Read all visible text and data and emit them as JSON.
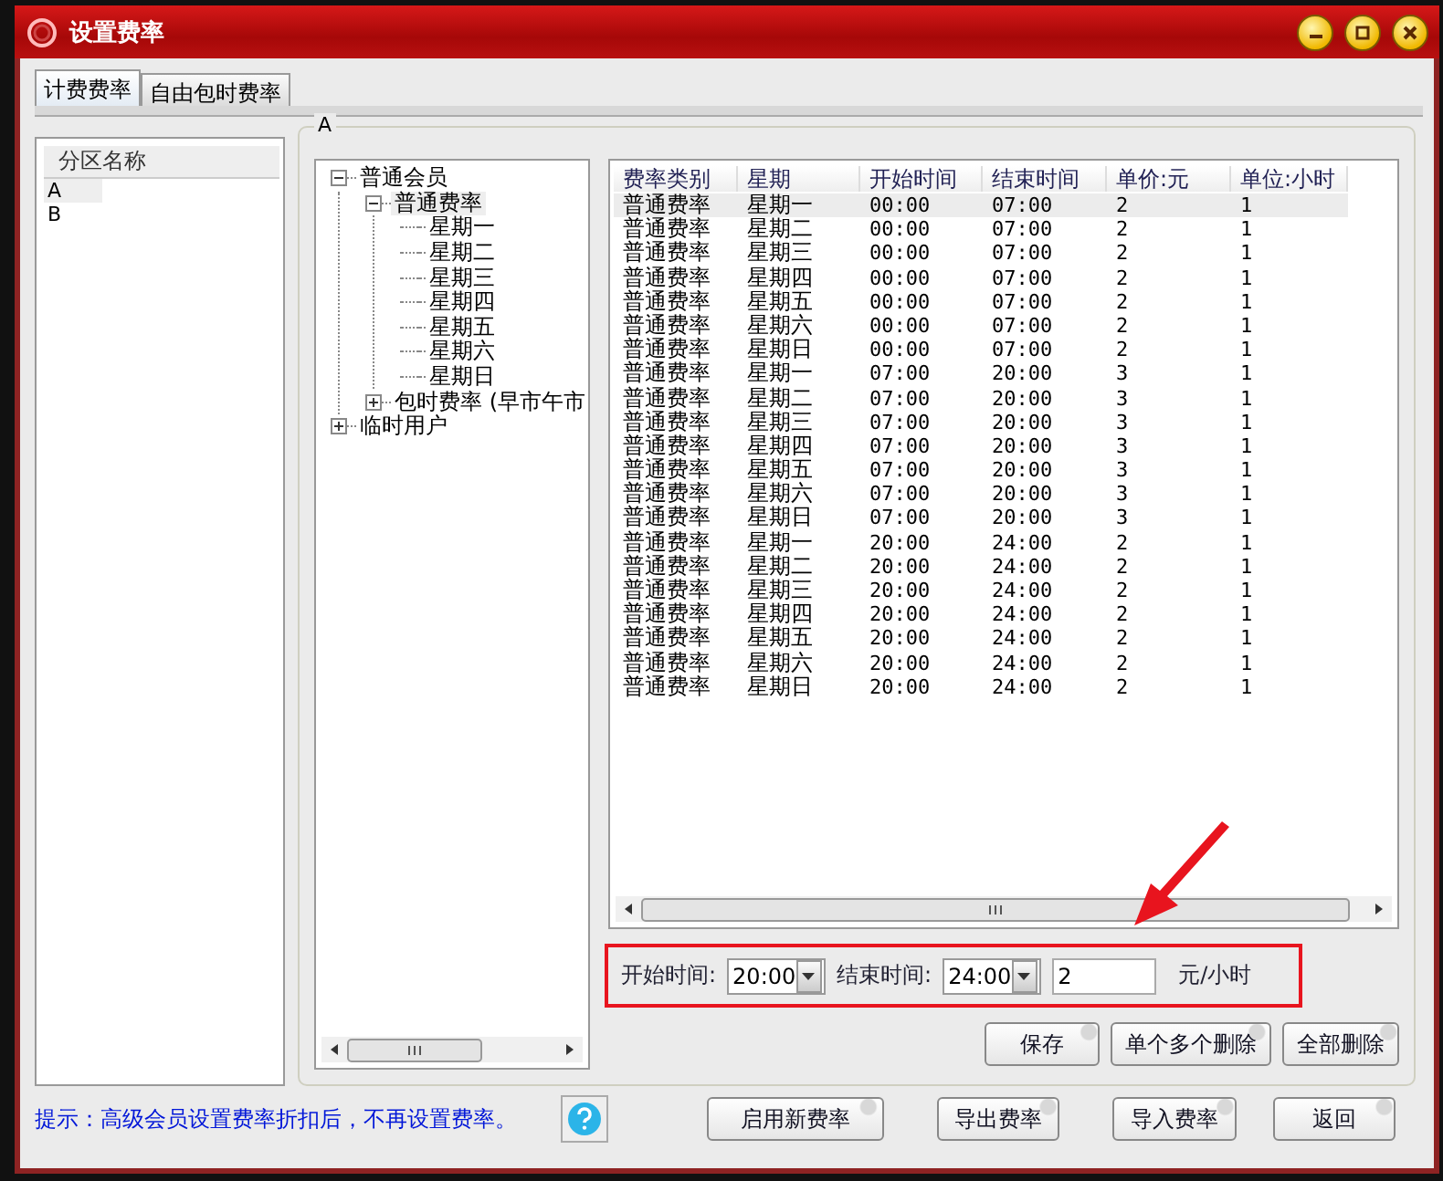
{
  "window": {
    "title": "设置费率"
  },
  "tabs": [
    {
      "label": "计费费率",
      "selected": true
    },
    {
      "label": "自由包时费率",
      "selected": false
    }
  ],
  "partition_list": {
    "header": "分区名称",
    "items": [
      {
        "label": "A",
        "selected": true
      },
      {
        "label": "B",
        "selected": false
      }
    ]
  },
  "group_title": "A",
  "tree": [
    {
      "label": "普通会员",
      "expanded": true,
      "selected": false,
      "children": [
        {
          "label": "普通费率",
          "expanded": true,
          "selected": true,
          "children": [
            {
              "label": "星期一",
              "selected": false
            },
            {
              "label": "星期二",
              "selected": false
            },
            {
              "label": "星期三",
              "selected": false
            },
            {
              "label": "星期四",
              "selected": false
            },
            {
              "label": "星期五",
              "selected": false
            },
            {
              "label": "星期六",
              "selected": false
            },
            {
              "label": "星期日",
              "selected": false
            }
          ]
        },
        {
          "label": "包时费率 (早市午市",
          "expanded": false,
          "selected": false
        }
      ]
    },
    {
      "label": "临时用户",
      "expanded": false,
      "selected": false
    }
  ],
  "table": {
    "columns": [
      "费率类别",
      "星期",
      "开始时间",
      "结束时间",
      "单价:元",
      "单位:小时"
    ],
    "rows": [
      {
        "cells": [
          "普通费率",
          "星期一",
          "00:00",
          "07:00",
          "2",
          "1"
        ],
        "selected": true
      },
      {
        "cells": [
          "普通费率",
          "星期二",
          "00:00",
          "07:00",
          "2",
          "1"
        ],
        "selected": false
      },
      {
        "cells": [
          "普通费率",
          "星期三",
          "00:00",
          "07:00",
          "2",
          "1"
        ],
        "selected": false
      },
      {
        "cells": [
          "普通费率",
          "星期四",
          "00:00",
          "07:00",
          "2",
          "1"
        ],
        "selected": false
      },
      {
        "cells": [
          "普通费率",
          "星期五",
          "00:00",
          "07:00",
          "2",
          "1"
        ],
        "selected": false
      },
      {
        "cells": [
          "普通费率",
          "星期六",
          "00:00",
          "07:00",
          "2",
          "1"
        ],
        "selected": false
      },
      {
        "cells": [
          "普通费率",
          "星期日",
          "00:00",
          "07:00",
          "2",
          "1"
        ],
        "selected": false
      },
      {
        "cells": [
          "普通费率",
          "星期一",
          "07:00",
          "20:00",
          "3",
          "1"
        ],
        "selected": false
      },
      {
        "cells": [
          "普通费率",
          "星期二",
          "07:00",
          "20:00",
          "3",
          "1"
        ],
        "selected": false
      },
      {
        "cells": [
          "普通费率",
          "星期三",
          "07:00",
          "20:00",
          "3",
          "1"
        ],
        "selected": false
      },
      {
        "cells": [
          "普通费率",
          "星期四",
          "07:00",
          "20:00",
          "3",
          "1"
        ],
        "selected": false
      },
      {
        "cells": [
          "普通费率",
          "星期五",
          "07:00",
          "20:00",
          "3",
          "1"
        ],
        "selected": false
      },
      {
        "cells": [
          "普通费率",
          "星期六",
          "07:00",
          "20:00",
          "3",
          "1"
        ],
        "selected": false
      },
      {
        "cells": [
          "普通费率",
          "星期日",
          "07:00",
          "20:00",
          "3",
          "1"
        ],
        "selected": false
      },
      {
        "cells": [
          "普通费率",
          "星期一",
          "20:00",
          "24:00",
          "2",
          "1"
        ],
        "selected": false
      },
      {
        "cells": [
          "普通费率",
          "星期二",
          "20:00",
          "24:00",
          "2",
          "1"
        ],
        "selected": false
      },
      {
        "cells": [
          "普通费率",
          "星期三",
          "20:00",
          "24:00",
          "2",
          "1"
        ],
        "selected": false
      },
      {
        "cells": [
          "普通费率",
          "星期四",
          "20:00",
          "24:00",
          "2",
          "1"
        ],
        "selected": false
      },
      {
        "cells": [
          "普通费率",
          "星期五",
          "20:00",
          "24:00",
          "2",
          "1"
        ],
        "selected": false
      },
      {
        "cells": [
          "普通费率",
          "星期六",
          "20:00",
          "24:00",
          "2",
          "1"
        ],
        "selected": false
      },
      {
        "cells": [
          "普通费率",
          "星期日",
          "20:00",
          "24:00",
          "2",
          "1"
        ],
        "selected": false
      }
    ]
  },
  "rate_form": {
    "start_label": "开始时间:",
    "start_value": "20:00",
    "end_label": "结束时间:",
    "end_value": "24:00",
    "price_value": "2",
    "unit": "元/小时"
  },
  "action_buttons": [
    "保存",
    "单个多个删除",
    "全部删除"
  ],
  "hint": "提示：高级会员设置费率折扣后，不再设置费率。",
  "bottom_buttons": [
    "启用新费率",
    "导出费率",
    "导入费率",
    "返回"
  ]
}
